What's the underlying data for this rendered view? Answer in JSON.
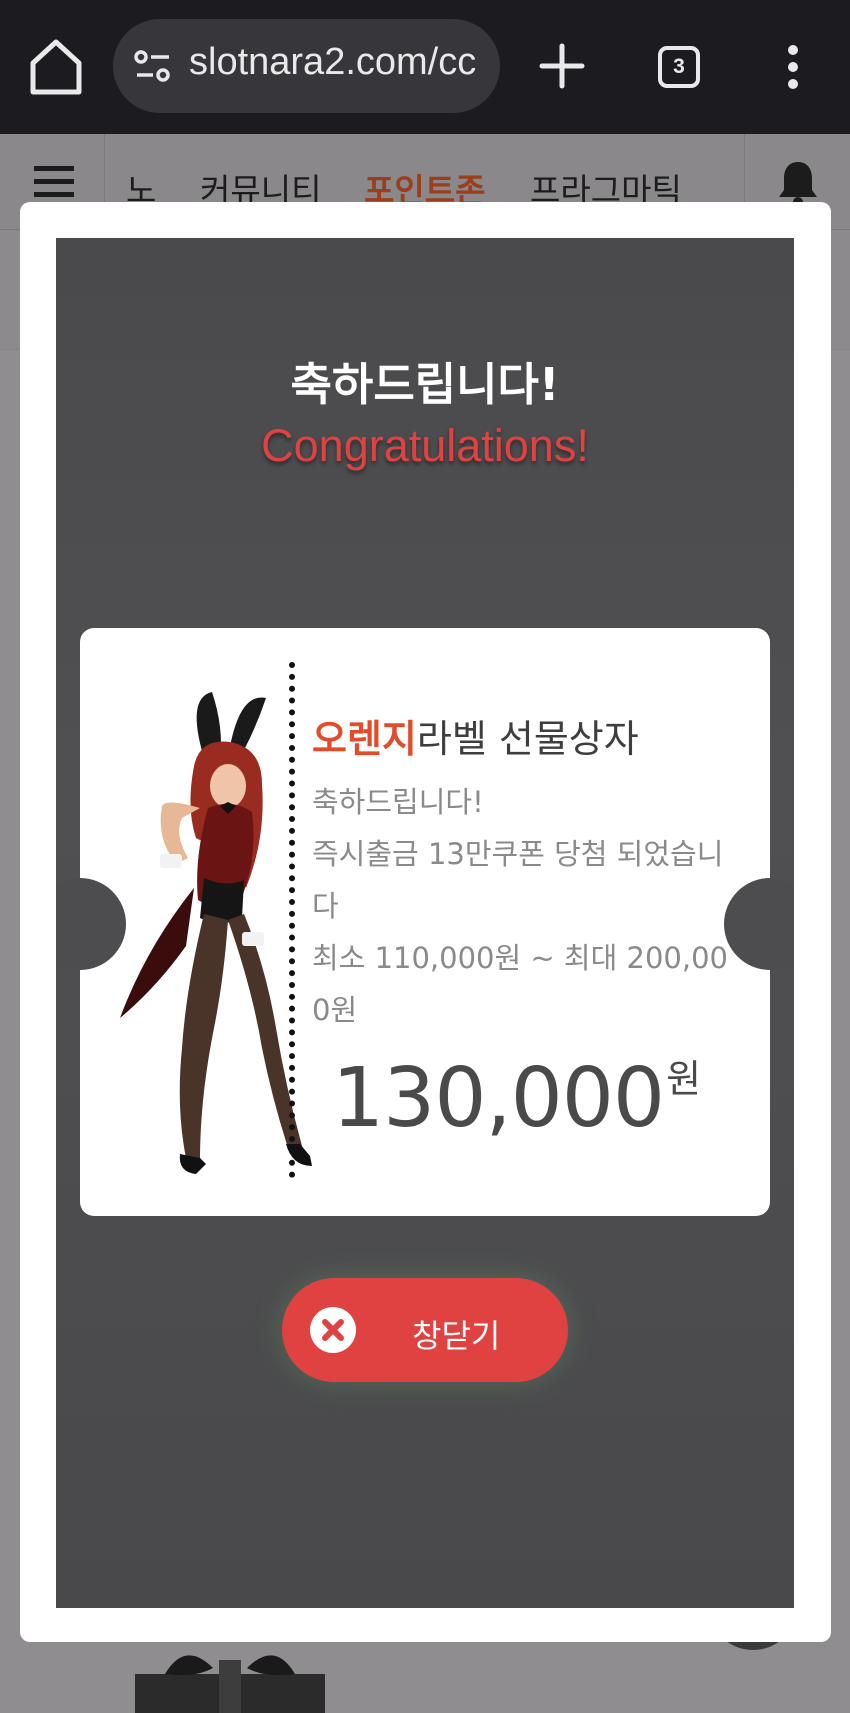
{
  "browser": {
    "url": "slotnara2.com/cc",
    "tab_count": "3",
    "icons": [
      "home-icon",
      "site-settings-icon",
      "new-tab-icon",
      "tab-switcher-icon",
      "more-menu-icon"
    ]
  },
  "site_nav": {
    "items": [
      "노",
      "커뮤니티",
      "포인트존",
      "프라그마틱"
    ],
    "active_index": 2,
    "icons": [
      "hamburger-icon",
      "bell-icon"
    ]
  },
  "popup": {
    "title_ko": "축하드립니다!",
    "title_en": "Congratulations!",
    "label_accent": "오렌지",
    "label_rest": "라벨 선물상자",
    "desc_lines": [
      "축하드립니다!",
      "즉시출금 13만쿠폰 당첨 되었습니다",
      "최소 110,000원 ~ 최대 200,000원"
    ],
    "amount": "130,000",
    "amount_unit": "원",
    "close_label": "창닫기"
  },
  "colors": {
    "accent_red": "#e04242",
    "accent_orange": "#e34c2b",
    "modal_bg": "#4d4d4f",
    "chrome_bg": "#1c1c20"
  }
}
